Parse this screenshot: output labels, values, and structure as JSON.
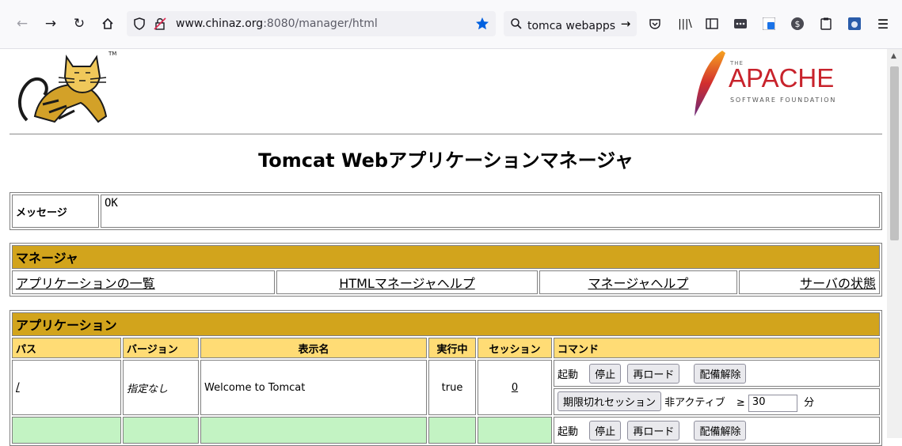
{
  "browser": {
    "url_host": "www.chinaz.org",
    "url_rest": ":8080/manager/html",
    "search_text": "tomca webapps リ"
  },
  "logos": {
    "apache_the": "THE",
    "apache_name": "APACHE",
    "apache_sub": "SOFTWARE FOUNDATION",
    "tm": "TM"
  },
  "title": "Tomcat Webアプリケーションマネージャ",
  "message": {
    "label": "メッセージ",
    "value": "OK"
  },
  "manager": {
    "heading": "マネージャ",
    "links": [
      "アプリケーションの一覧",
      "HTMLマネージャヘルプ",
      "マネージャヘルプ",
      "サーバの状態"
    ]
  },
  "applications": {
    "heading": "アプリケーション",
    "columns": [
      "パス",
      "バージョン",
      "表示名",
      "実行中",
      "セッション",
      "コマンド"
    ],
    "rows": [
      {
        "path": "/",
        "version": "指定なし",
        "display_name": "Welcome to Tomcat",
        "running": "true",
        "sessions": "0"
      },
      {
        "path": "",
        "version": "",
        "display_name": "",
        "running": "",
        "sessions": ""
      }
    ],
    "commands": {
      "start": "起動",
      "stop": "停止",
      "reload": "再ロード",
      "undeploy": "配備解除",
      "expire": "期限切れセッション",
      "inactive": "非アクティブ",
      "ge": "≥",
      "idle_value": "30",
      "minutes": "分"
    }
  },
  "colors": {
    "header_gold": "#d2a41c",
    "column_header": "#ffdc75",
    "row_alt": "#c3f3c3",
    "star": "#0060df"
  }
}
